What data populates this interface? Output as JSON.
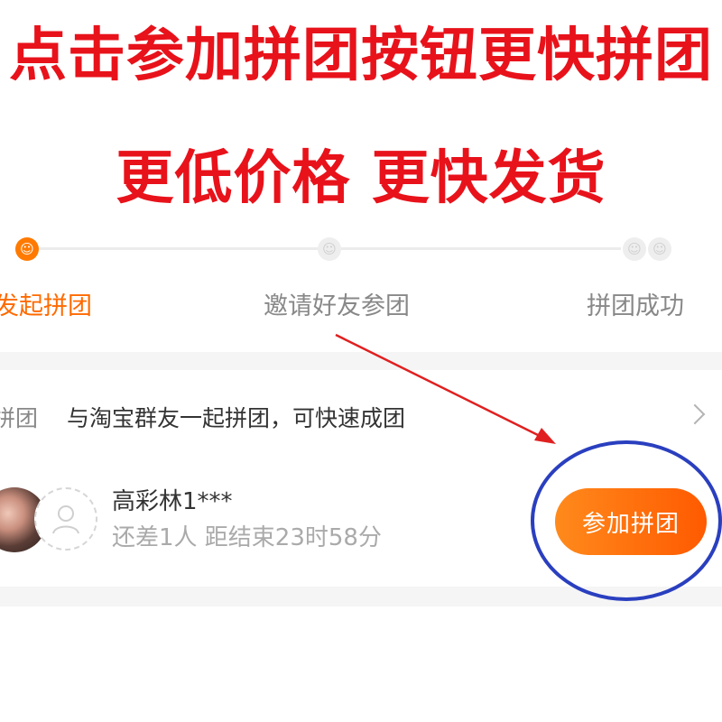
{
  "headline": {
    "line1": "点击参加拼团按钮更快拼团",
    "line2": "更低价格 更快发货"
  },
  "steps": [
    {
      "label": "发起拼团",
      "state": "active"
    },
    {
      "label": "邀请好友参团",
      "state": "inactive"
    },
    {
      "label": "拼团成功",
      "state": "inactive"
    }
  ],
  "group": {
    "left_label": "拼团",
    "invite_text": "与淘宝群友一起拼团，可快速成团",
    "member_name": "高彩林1***",
    "member_status": "还差1人 距结束23时58分",
    "join_label": "参加拼团"
  },
  "colors": {
    "headline": "#e8121b",
    "accent": "#ff6a00",
    "annotation_arrow": "#e02020",
    "annotation_circle": "#2a3fbf"
  }
}
